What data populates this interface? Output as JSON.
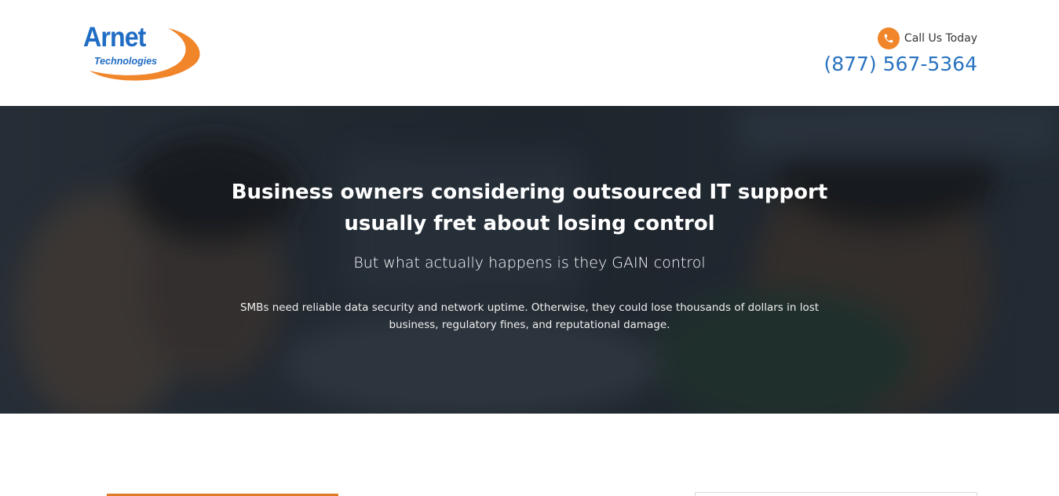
{
  "header": {
    "logo": {
      "word": "Arnet",
      "sub": "Technologies",
      "colors": {
        "blue": "#1f6cc4",
        "orange": "#f0852a"
      }
    },
    "call_label": "Call Us Today",
    "phone": "(877) 567-5364",
    "phone_icon": "phone-icon"
  },
  "hero": {
    "title_line1": "Business owners considering outsourced IT support",
    "title_line2": "usually fret about losing control",
    "subtitle": "But what actually happens is they GAIN control",
    "body_line1": "SMBs need reliable data security and network uptime. Otherwise, they could lose thousands of dollars in lost",
    "body_line2": "business, regulatory fines, and reputational damage."
  },
  "colors": {
    "accent": "#f0852a",
    "link": "#2a73c0",
    "hero_overlay": "#1e252c"
  }
}
